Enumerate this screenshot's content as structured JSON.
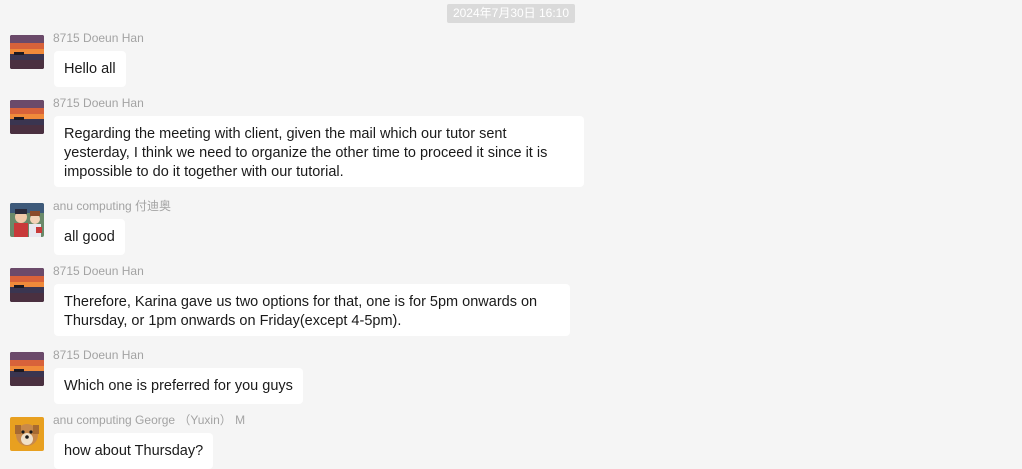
{
  "chat": {
    "timestamp": "2024年7月30日 16:10",
    "messages": [
      {
        "sender": "8715 Doeun Han",
        "avatar": "sunset-avatar",
        "text": "Hello all"
      },
      {
        "sender": "8715 Doeun Han",
        "avatar": "sunset-avatar",
        "text": "Regarding the meeting with client, given the mail which our tutor sent yesterday, I think we need to organize the other time to proceed it since it is impossible to do it together with our tutorial."
      },
      {
        "sender": "anu computing 付迪奥",
        "avatar": "anime-avatar",
        "text": "all good"
      },
      {
        "sender": "8715 Doeun Han",
        "avatar": "sunset-avatar",
        "text": "Therefore, Karina gave us two options for that, one is for 5pm onwards on Thursday, or 1pm onwards on Friday(except 4-5pm)."
      },
      {
        "sender": "8715 Doeun Han",
        "avatar": "sunset-avatar",
        "text": "Which one is preferred for you guys"
      },
      {
        "sender": "anu computing George （Yuxin） M",
        "avatar": "dog-avatar",
        "text": "how about Thursday?"
      }
    ]
  }
}
